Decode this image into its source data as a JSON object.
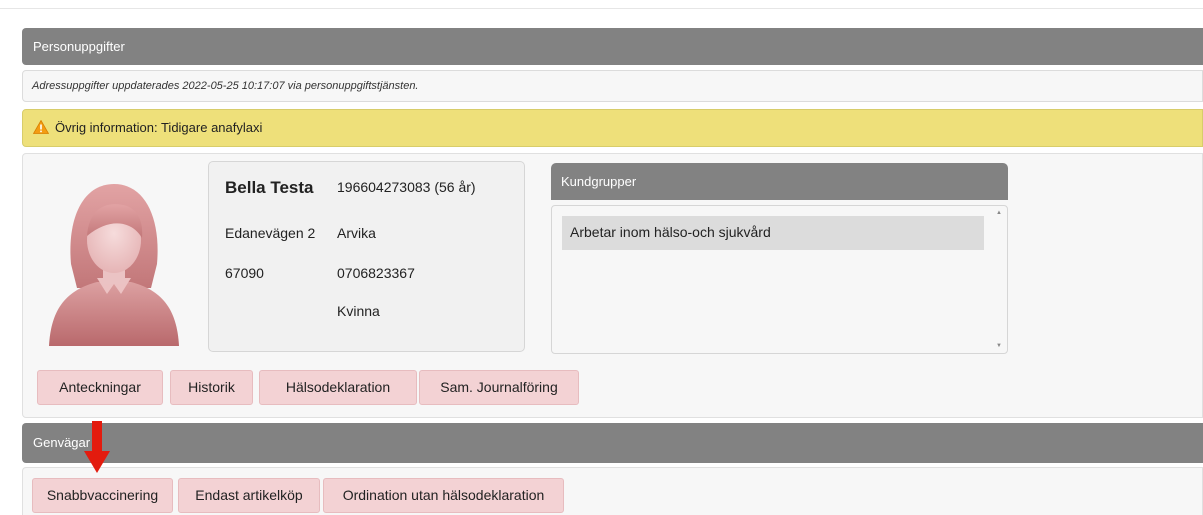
{
  "personuppgifter": {
    "header": "Personuppgifter",
    "address_update_note": "Adressuppgifter uppdaterades 2022-05-25 10:17:07 via personuppgiftstjänsten.",
    "warning": "Övrig information: Tidigare anafylaxi"
  },
  "person": {
    "name": "Bella Testa",
    "personal_number": "196604273083 (56 år)",
    "street": "Edanevägen 2",
    "city": "Arvika",
    "postal_code": "67090",
    "phone": "0706823367",
    "gender": "Kvinna"
  },
  "kundgrupper": {
    "header": "Kundgrupper",
    "items": [
      "Arbetar inom hälso-och sjukvård"
    ]
  },
  "person_buttons": [
    "Anteckningar",
    "Historik",
    "Hälsodeklaration",
    "Sam. Journalföring"
  ],
  "genvagar": {
    "header": "Genvägar",
    "buttons": [
      "Snabbvaccinering",
      "Endast artikelköp",
      "Ordination utan hälsodeklaration"
    ]
  },
  "colors": {
    "header_gray": "#828282",
    "warning_yellow": "#eee07a",
    "button_pink": "#f3d2d4",
    "arrow_red": "#e31b0e"
  },
  "icons": [
    "warning-icon",
    "female-avatar-icon",
    "red-down-arrow"
  ]
}
